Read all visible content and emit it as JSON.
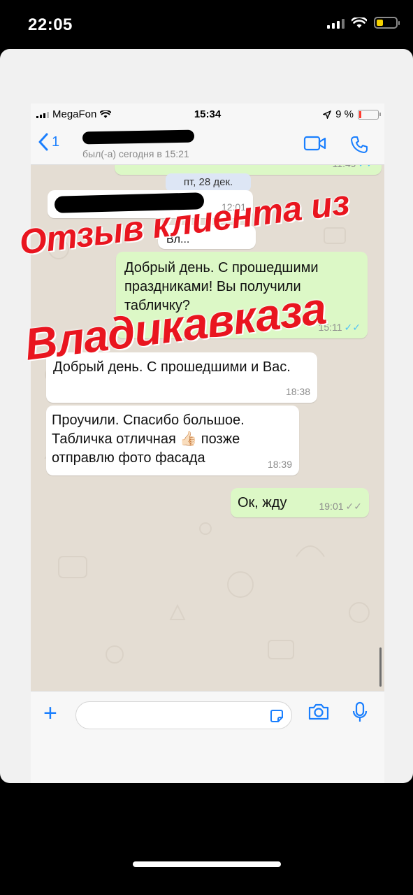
{
  "outer_status": {
    "time": "22:05",
    "battery_color": "#f5d200"
  },
  "inner_status": {
    "carrier": "MegaFon",
    "time": "15:34",
    "battery": "9 %"
  },
  "chat_header": {
    "back_count": "1",
    "contact_status": "был(-а) сегодня в 15:21",
    "accent": "#1a7ffe"
  },
  "chat": {
    "date_label": "пт, 28 дек.",
    "messages": [
      {
        "dir": "out",
        "text": "",
        "time": "11:49"
      },
      {
        "dir": "in",
        "text": "",
        "time": "12:01"
      },
      {
        "dir": "in",
        "text": "Вл...",
        "time": ""
      },
      {
        "dir": "out",
        "text": "Добрый день. С прошедшими праздниками! Вы получили табличку?",
        "time": "15:11"
      },
      {
        "dir": "in",
        "text": "Добрый день. С прошедшими и Вас.",
        "time": "18:38"
      },
      {
        "dir": "in",
        "text": "Проучили. Спасибо большое. Табличка отличная 👍🏻 позже отправлю фото фасада",
        "time": "18:39"
      },
      {
        "dir": "out",
        "text": "Ок, жду",
        "time": "19:01"
      }
    ]
  },
  "overlay": {
    "line1": "Отзыв клиента из",
    "line2": "Владикавказа",
    "color": "#e9151f"
  }
}
